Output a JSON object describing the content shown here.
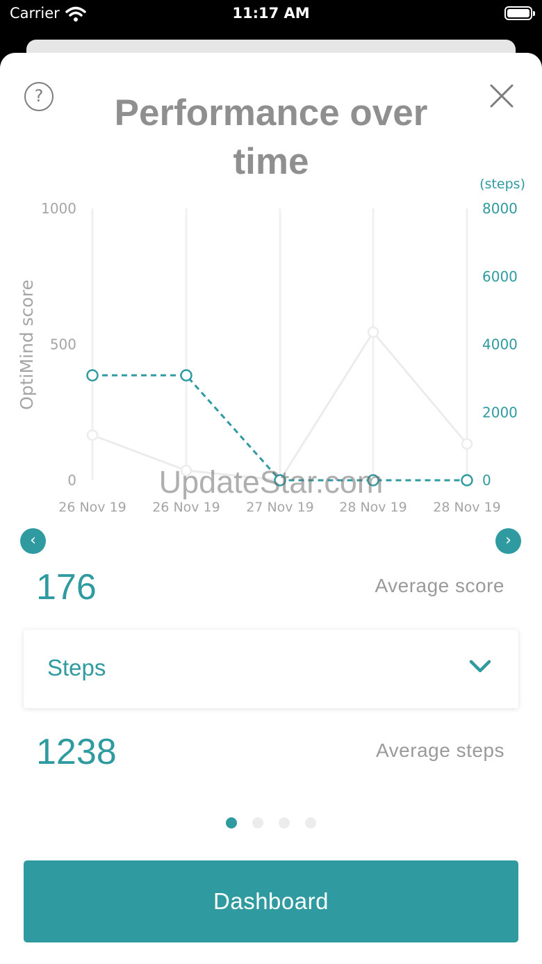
{
  "status_bar": {
    "carrier": "Carrier",
    "time": "11:17 AM"
  },
  "header": {
    "title": "Performance over time",
    "help_symbol": "?"
  },
  "icons": {
    "help": "question-circle-icon",
    "close": "close-icon",
    "prev": "chevron-left-icon",
    "next": "chevron-right-icon",
    "dropdown": "chevron-down-icon"
  },
  "colors": {
    "accent": "#2f9aa0",
    "score_line": "#ececec",
    "grid": "#f0f0f0",
    "muted_text": "#9a9a9a"
  },
  "chart_data": {
    "type": "line",
    "categories": [
      "26 Nov 19",
      "26 Nov 19",
      "27 Nov 19",
      "28 Nov 19",
      "28 Nov 19"
    ],
    "series": [
      {
        "name": "",
        "axis": "left",
        "values": [
          166,
          36,
          0,
          545,
          134
        ],
        "style": "solid",
        "color": "#ececec"
      },
      {
        "name": "",
        "axis": "right",
        "values": [
          3089,
          3089,
          0,
          0,
          0
        ],
        "style": "dashed",
        "color": "#2f9aa0"
      }
    ],
    "y_left": {
      "label": "OptiMind score",
      "ticks": [
        "1000",
        "500",
        "0"
      ],
      "range": [
        0,
        1000
      ]
    },
    "y_right": {
      "label": "(steps)",
      "ticks": [
        "8000",
        "6000",
        "4000",
        "2000",
        "0"
      ],
      "range": [
        0,
        8000
      ]
    },
    "grid": "vertical"
  },
  "stats": {
    "average_score": "176",
    "average_score_label": "Average score",
    "average_steps": "1238",
    "average_steps_label": "Average steps"
  },
  "metric_dropdown": {
    "selected": "Steps"
  },
  "pagination": {
    "count": 4,
    "active": 0
  },
  "footer": {
    "dashboard_label": "Dashboard"
  },
  "watermark": "UpdateStar.com"
}
